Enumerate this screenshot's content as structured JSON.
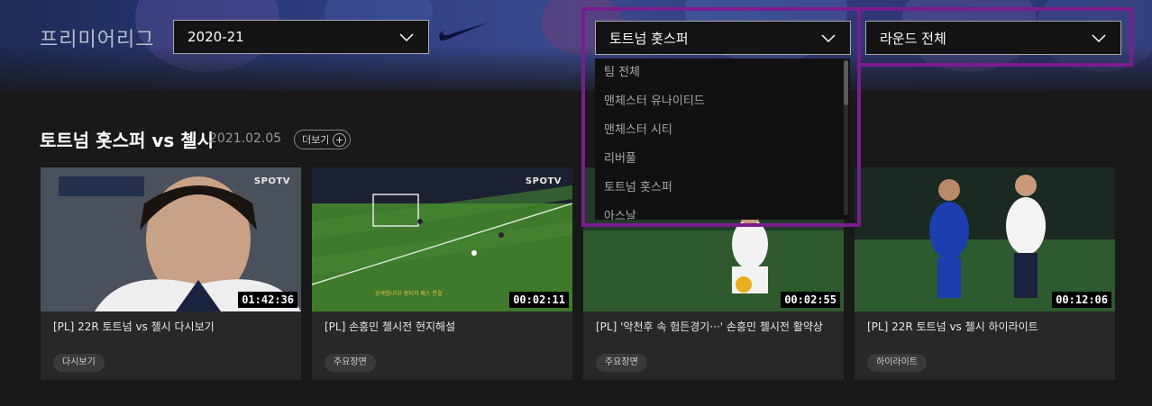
{
  "header": {
    "league_title": "프리미어리그",
    "season_select": {
      "value": "2020-21"
    },
    "team_select": {
      "value": "토트넘 홋스퍼"
    },
    "round_select": {
      "value": "라운드 전체"
    },
    "team_dropdown_options": [
      "팀 전체",
      "맨체스터 유나이티드",
      "맨체스터 시티",
      "리버풀",
      "토트넘 홋스퍼",
      "아스날"
    ]
  },
  "match": {
    "title": "토트넘 홋스퍼 vs 첼시",
    "date": "2021.02.05",
    "more_label": "더보기"
  },
  "videos": [
    {
      "title": "[PL] 22R 토트넘 vs 첼시 다시보기",
      "duration": "01:42:36",
      "tag": "다시보기",
      "brand": "SPOTV"
    },
    {
      "title": "[PL] 손흥민 첼시전 현지해설",
      "duration": "00:02:11",
      "tag": "주요장면",
      "brand": "SPOTV"
    },
    {
      "title": "[PL] '악천후 속 험든경기···' 손흥민 첼시전 활약상",
      "duration": "00:02:55",
      "tag": "주요장면",
      "brand": ""
    },
    {
      "title": "[PL] 22R 토트넘 vs 첼시 하이라이트",
      "duration": "00:12:06",
      "tag": "하이라이트",
      "brand": ""
    }
  ],
  "colors": {
    "highlight_border": "#7b1c8f",
    "background": "#191919",
    "card": "#282828"
  }
}
